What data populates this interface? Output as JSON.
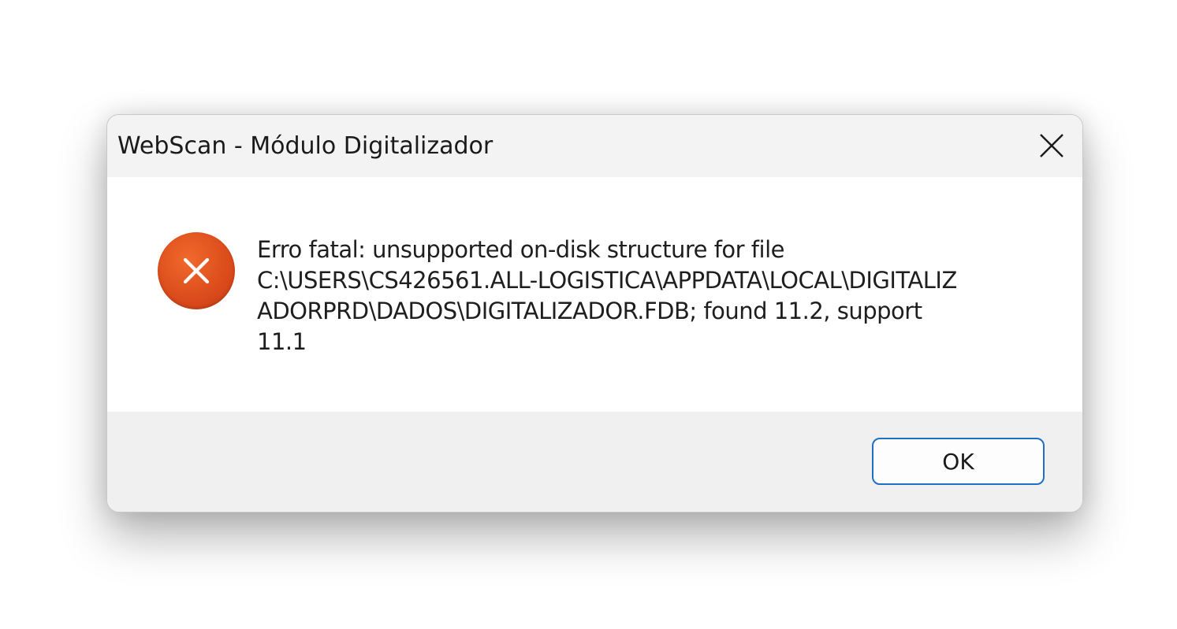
{
  "dialog": {
    "title": "WebScan - Módulo Digitalizador",
    "close_icon": "close-icon",
    "icon": "error-icon",
    "message": "Erro fatal: unsupported on-disk structure for file\nC:\\USERS\\CS426561.ALL-LOGISTICA\\APPDATA\\LOCAL\\DIGITALIZ\nADORPRD\\DADOS\\DIGITALIZADOR.FDB; found 11.2, support\n11.1",
    "ok_label": "OK"
  },
  "colors": {
    "error_icon": "#d9481a",
    "button_border": "#1f6fc4",
    "titlebar": "#f3f3f3",
    "footer": "#f0f0f0"
  }
}
